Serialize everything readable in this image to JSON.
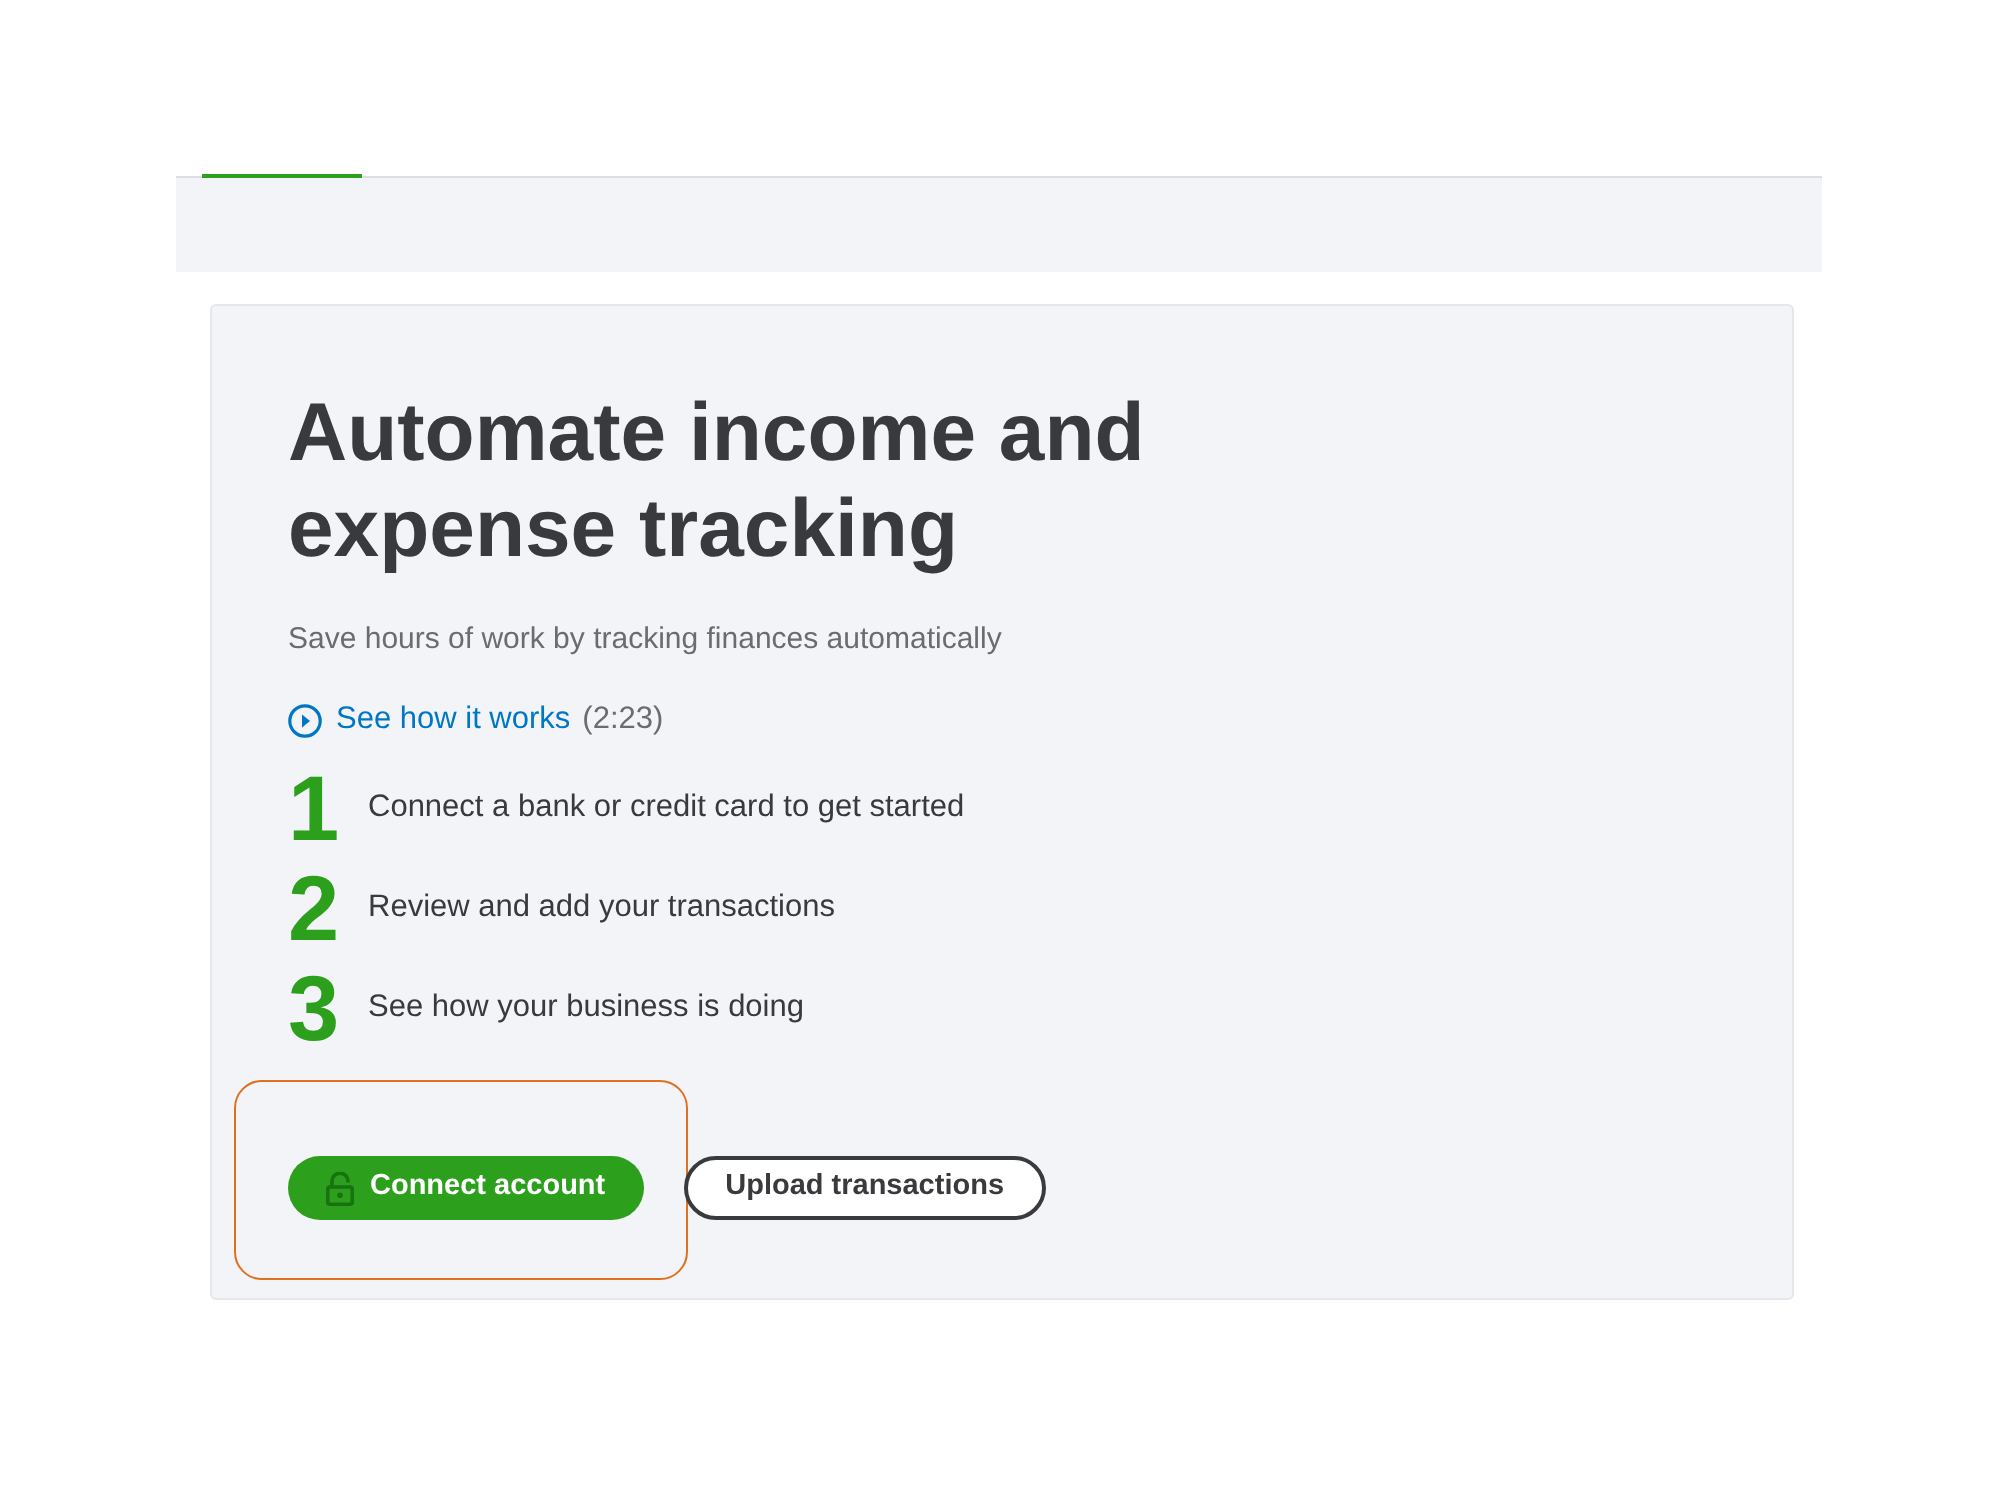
{
  "tabs": [
    {
      "selected": true
    }
  ],
  "card": {
    "title": "Automate income and expense tracking",
    "subtitle": "Save hours of work by tracking finances automatically",
    "video_link": {
      "label": "See how it works",
      "duration": "(2:23)"
    },
    "steps": [
      {
        "number": "1",
        "text": "Connect a bank or credit card to get started"
      },
      {
        "number": "2",
        "text": "Review and add your transactions"
      },
      {
        "number": "3",
        "text": "See how your business is doing"
      }
    ],
    "buttons": [
      {
        "kind": "primary",
        "label": "Connect account",
        "highlighted": true
      },
      {
        "kind": "secondary",
        "label": "Upload transactions",
        "highlighted": false
      }
    ]
  }
}
